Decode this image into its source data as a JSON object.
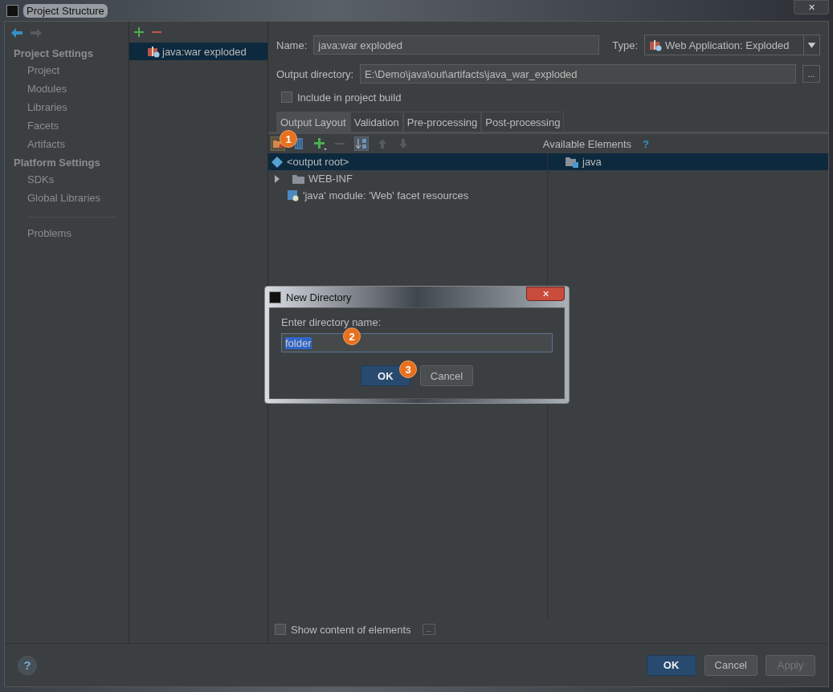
{
  "window": {
    "title": "Project Structure",
    "close": "✕"
  },
  "sidebar": {
    "sections": [
      {
        "title": "Project Settings",
        "items": [
          {
            "label": "Project",
            "selected": false
          },
          {
            "label": "Modules",
            "selected": false
          },
          {
            "label": "Libraries",
            "selected": false
          },
          {
            "label": "Facets",
            "selected": false
          },
          {
            "label": "Artifacts",
            "selected": false
          }
        ]
      },
      {
        "title": "Platform Settings",
        "items": [
          {
            "label": "SDKs",
            "selected": false
          },
          {
            "label": "Global Libraries",
            "selected": false
          }
        ]
      }
    ],
    "extra": [
      {
        "label": "Problems",
        "selected": false
      }
    ]
  },
  "artifacts": [
    {
      "label": "java:war exploded",
      "selected": true
    }
  ],
  "form": {
    "name_label": "Name:",
    "name_value": "java:war exploded",
    "type_label": "Type:",
    "type_value": "Web Application: Exploded",
    "output_label": "Output directory:",
    "output_value": "E:\\Demo\\java\\out\\artifacts\\java_war_exploded",
    "browse": "...",
    "include": {
      "label": "Include in project build",
      "checked": false
    }
  },
  "tabs": [
    {
      "label": "Output Layout",
      "selected": true
    },
    {
      "label": "Validation",
      "selected": false
    },
    {
      "label": "Pre-processing",
      "selected": false
    },
    {
      "label": "Post-processing",
      "selected": false
    }
  ],
  "layout_tree": [
    {
      "label": "<output root>",
      "kind": "root",
      "selected": true
    },
    {
      "label": "WEB-INF",
      "kind": "folder",
      "expanded": false,
      "selected": false
    },
    {
      "label": "'java' module: 'Web' facet resources",
      "kind": "module",
      "selected": false
    }
  ],
  "available": {
    "title": "Available Elements",
    "help": "?",
    "items": [
      {
        "label": "java",
        "selected": true
      }
    ]
  },
  "show_content": {
    "label": "Show content of elements",
    "checked": false,
    "more": "..."
  },
  "footer": {
    "help": "?",
    "buttons": [
      {
        "label": "OK",
        "kind": "primary",
        "disabled": false
      },
      {
        "label": "Cancel",
        "kind": "normal",
        "disabled": false
      },
      {
        "label": "Apply",
        "kind": "normal",
        "disabled": true
      }
    ]
  },
  "dialog": {
    "title": "New Directory",
    "close": "✕",
    "prompt": "Enter directory name:",
    "value": "folder",
    "buttons": [
      {
        "label": "OK",
        "kind": "primary"
      },
      {
        "label": "Cancel",
        "kind": "normal"
      }
    ]
  },
  "callouts": [
    "1",
    "2",
    "3"
  ]
}
